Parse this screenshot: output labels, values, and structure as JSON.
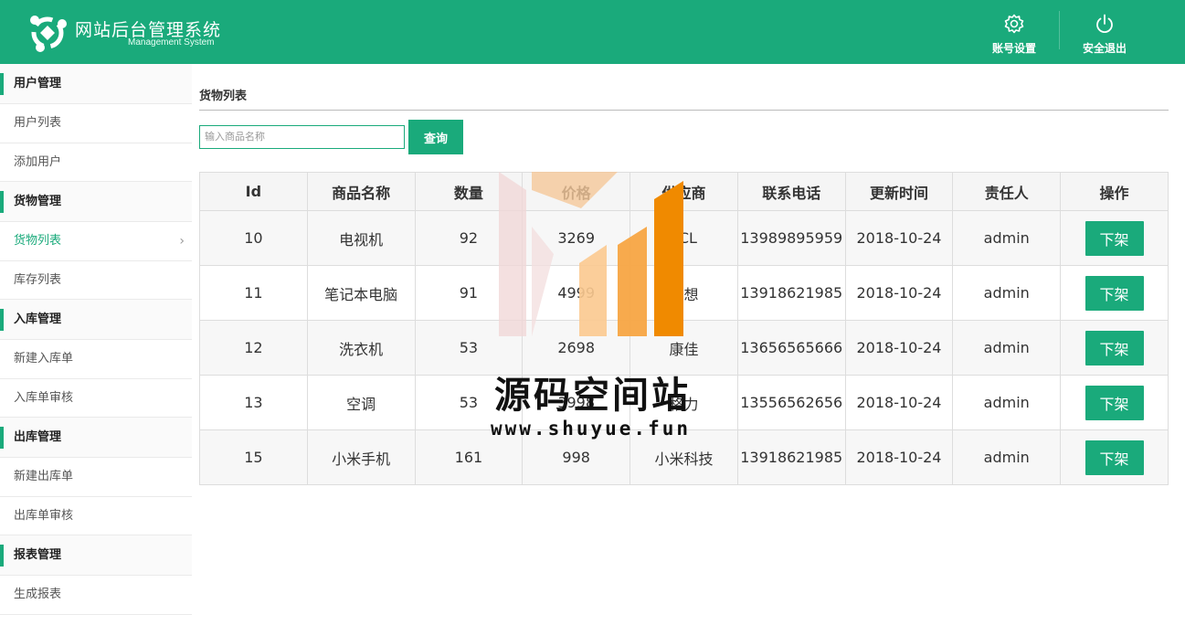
{
  "header": {
    "title": "网站后台管理系统",
    "subtitle": "Management System",
    "account_label": "账号设置",
    "logout_label": "安全退出"
  },
  "sidebar": {
    "groups": [
      {
        "label": "用户管理",
        "items": [
          {
            "label": "用户列表"
          },
          {
            "label": "添加用户"
          }
        ]
      },
      {
        "label": "货物管理",
        "items": [
          {
            "label": "货物列表",
            "active": true
          },
          {
            "label": "库存列表"
          }
        ]
      },
      {
        "label": "入库管理",
        "items": [
          {
            "label": "新建入库单"
          },
          {
            "label": "入库单审核"
          }
        ]
      },
      {
        "label": "出库管理",
        "items": [
          {
            "label": "新建出库单"
          },
          {
            "label": "出库单审核"
          }
        ]
      },
      {
        "label": "报表管理",
        "items": [
          {
            "label": "生成报表"
          }
        ]
      }
    ]
  },
  "main": {
    "title": "货物列表",
    "search": {
      "placeholder": "输入商品名称",
      "value": "",
      "button": "查询"
    },
    "table": {
      "headers": [
        "Id",
        "商品名称",
        "数量",
        "价格",
        "供应商",
        "联系电话",
        "更新时间",
        "责任人",
        "操作"
      ],
      "rows": [
        [
          "10",
          "电视机",
          "92",
          "3269",
          "TCL",
          "13989895959",
          "2018-10-24",
          "admin",
          "下架"
        ],
        [
          "11",
          "笔记本电脑",
          "91",
          "4999",
          "联想",
          "13918621985",
          "2018-10-24",
          "admin",
          "下架"
        ],
        [
          "12",
          "洗衣机",
          "53",
          "2698",
          "康佳",
          "13656565666",
          "2018-10-24",
          "admin",
          "下架"
        ],
        [
          "13",
          "空调",
          "53",
          "3998",
          "格力",
          "13556562656",
          "2018-10-24",
          "admin",
          "下架"
        ],
        [
          "15",
          "小米手机",
          "161",
          "998",
          "小米科技",
          "13918621985",
          "2018-10-24",
          "admin",
          "下架"
        ]
      ]
    }
  },
  "watermark": {
    "title": "源码空间站",
    "url": "www.shuyue.fun"
  },
  "colors": {
    "accent": "#1aaa7b",
    "watermark_orange": "#f39c12"
  }
}
